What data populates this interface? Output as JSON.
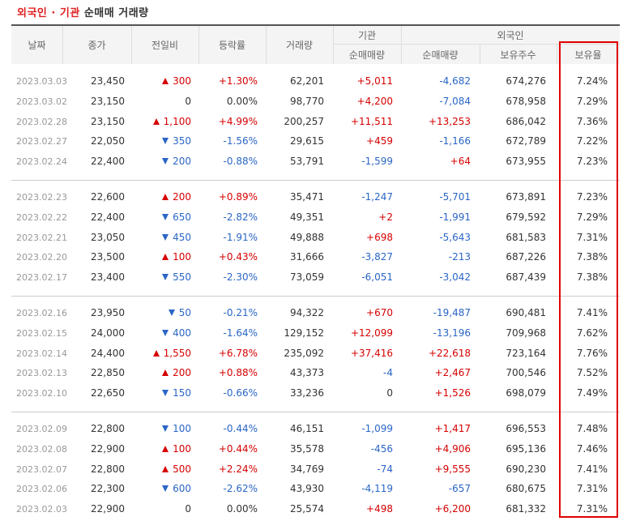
{
  "caption": {
    "part1": "외국인 · 기관",
    "part2": "순매매 거래량"
  },
  "headers": {
    "date": "날짜",
    "close": "종가",
    "diff": "전일비",
    "rate": "등락률",
    "volume": "거래량",
    "inst_group": "기관",
    "inst_net": "순매매량",
    "foreign_group": "외국인",
    "foreign_net": "순매매량",
    "foreign_hold": "보유주수",
    "foreign_ratio": "보유율"
  },
  "colors": {
    "up": "#d60000",
    "down": "#2a66c6",
    "highlight": "#e00000"
  },
  "groups": [
    [
      {
        "date": "2023.03.03",
        "close": "23,450",
        "dir": "up",
        "diff": "300",
        "rate": "+1.30%",
        "volume": "62,201",
        "inst": "+5,011",
        "foreign": "-4,682",
        "hold": "674,276",
        "ratio": "7.24%"
      },
      {
        "date": "2023.03.02",
        "close": "23,150",
        "dir": "flat",
        "diff": "0",
        "rate": "0.00%",
        "volume": "98,770",
        "inst": "+4,200",
        "foreign": "-7,084",
        "hold": "678,958",
        "ratio": "7.29%"
      },
      {
        "date": "2023.02.28",
        "close": "23,150",
        "dir": "up",
        "diff": "1,100",
        "rate": "+4.99%",
        "volume": "200,257",
        "inst": "+11,511",
        "foreign": "+13,253",
        "hold": "686,042",
        "ratio": "7.36%"
      },
      {
        "date": "2023.02.27",
        "close": "22,050",
        "dir": "down",
        "diff": "350",
        "rate": "-1.56%",
        "volume": "29,615",
        "inst": "+459",
        "foreign": "-1,166",
        "hold": "672,789",
        "ratio": "7.22%"
      },
      {
        "date": "2023.02.24",
        "close": "22,400",
        "dir": "down",
        "diff": "200",
        "rate": "-0.88%",
        "volume": "53,791",
        "inst": "-1,599",
        "foreign": "+64",
        "hold": "673,955",
        "ratio": "7.23%"
      }
    ],
    [
      {
        "date": "2023.02.23",
        "close": "22,600",
        "dir": "up",
        "diff": "200",
        "rate": "+0.89%",
        "volume": "35,471",
        "inst": "-1,247",
        "foreign": "-5,701",
        "hold": "673,891",
        "ratio": "7.23%"
      },
      {
        "date": "2023.02.22",
        "close": "22,400",
        "dir": "down",
        "diff": "650",
        "rate": "-2.82%",
        "volume": "49,351",
        "inst": "+2",
        "foreign": "-1,991",
        "hold": "679,592",
        "ratio": "7.29%"
      },
      {
        "date": "2023.02.21",
        "close": "23,050",
        "dir": "down",
        "diff": "450",
        "rate": "-1.91%",
        "volume": "49,888",
        "inst": "+698",
        "foreign": "-5,643",
        "hold": "681,583",
        "ratio": "7.31%"
      },
      {
        "date": "2023.02.20",
        "close": "23,500",
        "dir": "up",
        "diff": "100",
        "rate": "+0.43%",
        "volume": "31,666",
        "inst": "-3,827",
        "foreign": "-213",
        "hold": "687,226",
        "ratio": "7.38%"
      },
      {
        "date": "2023.02.17",
        "close": "23,400",
        "dir": "down",
        "diff": "550",
        "rate": "-2.30%",
        "volume": "73,059",
        "inst": "-6,051",
        "foreign": "-3,042",
        "hold": "687,439",
        "ratio": "7.38%"
      }
    ],
    [
      {
        "date": "2023.02.16",
        "close": "23,950",
        "dir": "down",
        "diff": "50",
        "rate": "-0.21%",
        "volume": "94,322",
        "inst": "+670",
        "foreign": "-19,487",
        "hold": "690,481",
        "ratio": "7.41%"
      },
      {
        "date": "2023.02.15",
        "close": "24,000",
        "dir": "down",
        "diff": "400",
        "rate": "-1.64%",
        "volume": "129,152",
        "inst": "+12,099",
        "foreign": "-13,196",
        "hold": "709,968",
        "ratio": "7.62%"
      },
      {
        "date": "2023.02.14",
        "close": "24,400",
        "dir": "up",
        "diff": "1,550",
        "rate": "+6.78%",
        "volume": "235,092",
        "inst": "+37,416",
        "foreign": "+22,618",
        "hold": "723,164",
        "ratio": "7.76%"
      },
      {
        "date": "2023.02.13",
        "close": "22,850",
        "dir": "up",
        "diff": "200",
        "rate": "+0.88%",
        "volume": "43,373",
        "inst": "-4",
        "foreign": "+2,467",
        "hold": "700,546",
        "ratio": "7.52%"
      },
      {
        "date": "2023.02.10",
        "close": "22,650",
        "dir": "down",
        "diff": "150",
        "rate": "-0.66%",
        "volume": "33,236",
        "inst": "0",
        "foreign": "+1,526",
        "hold": "698,079",
        "ratio": "7.49%"
      }
    ],
    [
      {
        "date": "2023.02.09",
        "close": "22,800",
        "dir": "down",
        "diff": "100",
        "rate": "-0.44%",
        "volume": "46,151",
        "inst": "-1,099",
        "foreign": "+1,417",
        "hold": "696,553",
        "ratio": "7.48%"
      },
      {
        "date": "2023.02.08",
        "close": "22,900",
        "dir": "up",
        "diff": "100",
        "rate": "+0.44%",
        "volume": "35,578",
        "inst": "-456",
        "foreign": "+4,906",
        "hold": "695,136",
        "ratio": "7.46%"
      },
      {
        "date": "2023.02.07",
        "close": "22,800",
        "dir": "up",
        "diff": "500",
        "rate": "+2.24%",
        "volume": "34,769",
        "inst": "-74",
        "foreign": "+9,555",
        "hold": "690,230",
        "ratio": "7.41%"
      },
      {
        "date": "2023.02.06",
        "close": "22,300",
        "dir": "down",
        "diff": "600",
        "rate": "-2.62%",
        "volume": "43,930",
        "inst": "-4,119",
        "foreign": "-657",
        "hold": "680,675",
        "ratio": "7.31%"
      },
      {
        "date": "2023.02.03",
        "close": "22,900",
        "dir": "flat",
        "diff": "0",
        "rate": "0.00%",
        "volume": "25,574",
        "inst": "+498",
        "foreign": "+6,200",
        "hold": "681,332",
        "ratio": "7.31%"
      }
    ]
  ]
}
